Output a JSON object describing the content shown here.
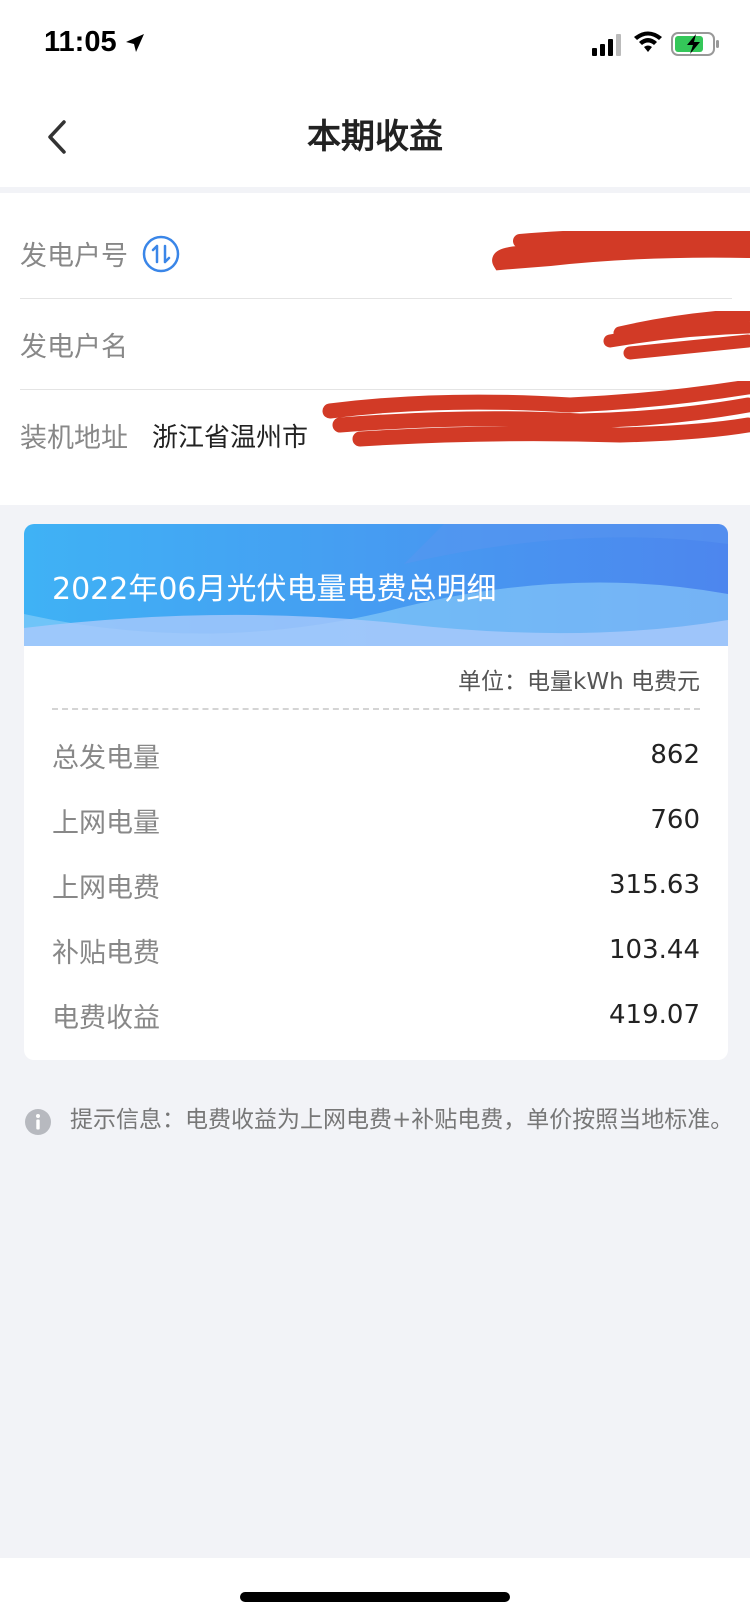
{
  "status_bar": {
    "time": "11:05"
  },
  "header": {
    "title": "本期收益"
  },
  "info": {
    "account_no_label": "发电户号",
    "account_name_label": "发电户名",
    "address_label": "装机地址",
    "address_value": "浙江省温州市"
  },
  "card": {
    "title": "2022年06月光伏电量电费总明细",
    "unit": "单位：电量kWh 电费元",
    "rows": [
      {
        "label": "总发电量",
        "value": "862"
      },
      {
        "label": "上网电量",
        "value": "760"
      },
      {
        "label": "上网电费",
        "value": "315.63"
      },
      {
        "label": "补贴电费",
        "value": "103.44"
      },
      {
        "label": "电费收益",
        "value": "419.07"
      }
    ]
  },
  "tip": {
    "text": "提示信息：电费收益为上网电费+补贴电费，单价按照当地标准。"
  },
  "colors": {
    "accent": "#3a86e8",
    "redaction": "#d23a26",
    "banner_start": "#3fb2f5",
    "banner_end": "#6e9ef2"
  },
  "icons": {
    "switch": "swap-arrows-icon",
    "info": "info-circle-icon",
    "back": "chevron-left-icon"
  }
}
